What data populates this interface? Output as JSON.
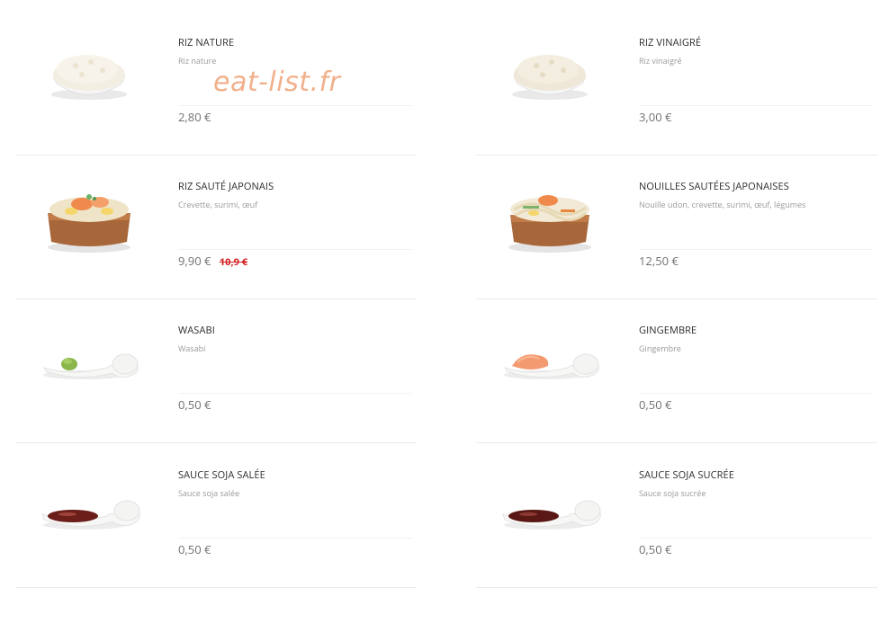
{
  "watermark": "eat-list.fr",
  "items": [
    {
      "title": "RIZ NATURE",
      "desc": "Riz nature",
      "price": "2,80 €",
      "old_price": "",
      "image": "rice-bowl-icon"
    },
    {
      "title": "RIZ VINAIGRÉ",
      "desc": "Riz vinaigré",
      "price": "3,00 €",
      "old_price": "",
      "image": "rice-bowl-icon"
    },
    {
      "title": "RIZ SAUTÉ JAPONAIS",
      "desc": "Crevette, surimi, œuf",
      "price": "9,90 €",
      "old_price": "10,9 €",
      "image": "fried-rice-icon"
    },
    {
      "title": "NOUILLES SAUTÉES JAPONAISES",
      "desc": "Nouille udon, crevette, surimi, œuf, légumes",
      "price": "12,50 €",
      "old_price": "",
      "image": "noodles-icon"
    },
    {
      "title": "WASABI",
      "desc": "Wasabi",
      "price": "0,50 €",
      "old_price": "",
      "image": "wasabi-icon"
    },
    {
      "title": "GINGEMBRE",
      "desc": "Gingembre",
      "price": "0,50 €",
      "old_price": "",
      "image": "ginger-icon"
    },
    {
      "title": "SAUCE SOJA SALÉE",
      "desc": "Sauce soja salée",
      "price": "0,50 €",
      "old_price": "",
      "image": "soy-sauce-icon"
    },
    {
      "title": "SAUCE SOJA SUCRÉE",
      "desc": "Sauce soja sucrée",
      "price": "0,50 €",
      "old_price": "",
      "image": "soy-sauce-icon"
    }
  ]
}
